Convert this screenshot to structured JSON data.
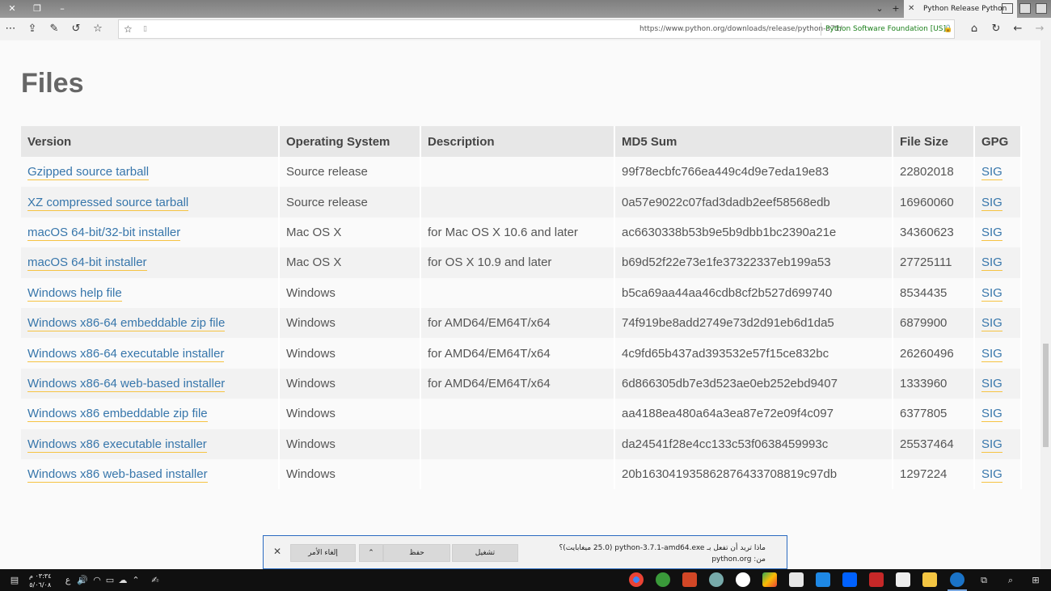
{
  "browser": {
    "tab_title": "Python Release Python",
    "url": "https://www.python.org/downloads/release/python-371/",
    "cert": "Python Software Foundation [US]"
  },
  "page": {
    "heading": "Files",
    "columns": [
      "Version",
      "Operating System",
      "Description",
      "MD5 Sum",
      "File Size",
      "GPG"
    ],
    "rows": [
      {
        "version": "Gzipped source tarball",
        "os": "Source release",
        "desc": "",
        "md5": "99f78ecbfc766ea449c4d9e7eda19e83",
        "size": "22802018",
        "gpg": "SIG"
      },
      {
        "version": "XZ compressed source tarball",
        "os": "Source release",
        "desc": "",
        "md5": "0a57e9022c07fad3dadb2eef58568edb",
        "size": "16960060",
        "gpg": "SIG"
      },
      {
        "version": "macOS 64-bit/32-bit installer",
        "os": "Mac OS X",
        "desc": "for Mac OS X 10.6 and later",
        "md5": "ac6630338b53b9e5b9dbb1bc2390a21e",
        "size": "34360623",
        "gpg": "SIG"
      },
      {
        "version": "macOS 64-bit installer",
        "os": "Mac OS X",
        "desc": "for OS X 10.9 and later",
        "md5": "b69d52f22e73e1fe37322337eb199a53",
        "size": "27725111",
        "gpg": "SIG"
      },
      {
        "version": "Windows help file",
        "os": "Windows",
        "desc": "",
        "md5": "b5ca69aa44aa46cdb8cf2b527d699740",
        "size": "8534435",
        "gpg": "SIG"
      },
      {
        "version": "Windows x86-64 embeddable zip file",
        "os": "Windows",
        "desc": "for AMD64/EM64T/x64",
        "md5": "74f919be8add2749e73d2d91eb6d1da5",
        "size": "6879900",
        "gpg": "SIG"
      },
      {
        "version": "Windows x86-64 executable installer",
        "os": "Windows",
        "desc": "for AMD64/EM64T/x64",
        "md5": "4c9fd65b437ad393532e57f15ce832bc",
        "size": "26260496",
        "gpg": "SIG"
      },
      {
        "version": "Windows x86-64 web-based installer",
        "os": "Windows",
        "desc": "for AMD64/EM64T/x64",
        "md5": "6d866305db7e3d523ae0eb252ebd9407",
        "size": "1333960",
        "gpg": "SIG"
      },
      {
        "version": "Windows x86 embeddable zip file",
        "os": "Windows",
        "desc": "",
        "md5": "aa4188ea480a64a3ea87e72e09f4c097",
        "size": "6377805",
        "gpg": "SIG"
      },
      {
        "version": "Windows x86 executable installer",
        "os": "Windows",
        "desc": "",
        "md5": "da24541f28e4cc133c53f0638459993c",
        "size": "25537464",
        "gpg": "SIG"
      },
      {
        "version": "Windows x86 web-based installer",
        "os": "Windows",
        "desc": "",
        "md5": "20b163041935862876433708819c97db",
        "size": "1297224",
        "gpg": "SIG"
      }
    ]
  },
  "download": {
    "message": "ماذا تريد أن تفعل بـ python-3.7.1-amd64.exe (25.0 ميغابايت)؟",
    "from": "من: python.org",
    "run": "تشغيل",
    "save": "حفظ",
    "cancel": "إلغاء الأمر"
  },
  "taskbar": {
    "time": "٠٣:٣٤ م",
    "date": "٥/٠٦/٠٨",
    "lang": "ع"
  },
  "colors": {
    "link": "#3776ab",
    "link_underline": "#f6c343",
    "header_bg": "#e7e7e7",
    "heading": "#666666"
  }
}
